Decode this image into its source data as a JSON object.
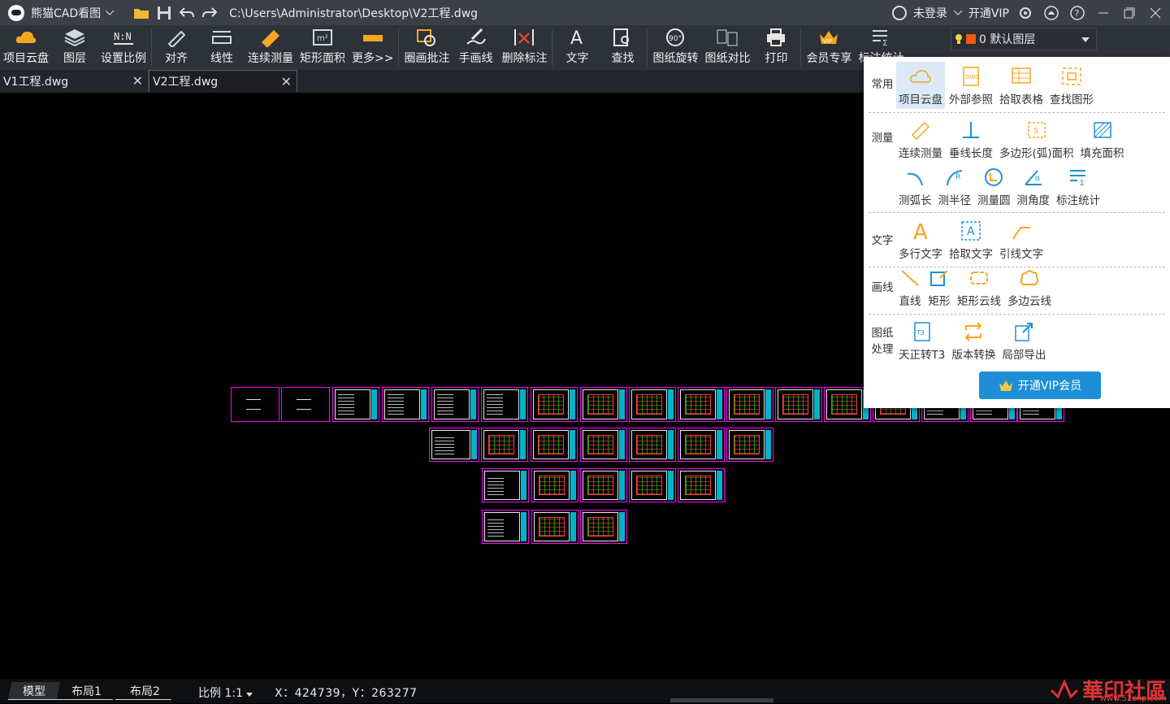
{
  "titlebar": {
    "app_name": "熊猫CAD看图",
    "file_path": "C:\\Users\\Administrator\\Desktop\\V2工程.dwg",
    "login": "未登录",
    "vip": "开通VIP"
  },
  "toolbar": {
    "items": [
      {
        "label": "项目云盘",
        "icon": "cloud-disk-icon"
      },
      {
        "label": "图层",
        "icon": "layers-icon"
      },
      {
        "label": "设置比例",
        "icon": "scale-ratio-icon"
      },
      {
        "label": "对齐",
        "icon": "align-icon"
      },
      {
        "label": "线性",
        "icon": "linear-measure-icon"
      },
      {
        "label": "连续测量",
        "icon": "continuous-measure-icon"
      },
      {
        "label": "矩形面积",
        "icon": "rect-area-icon"
      },
      {
        "label": "更多>>",
        "icon": "more-icon"
      },
      {
        "label": "圈画批注",
        "icon": "circle-annotate-icon"
      },
      {
        "label": "手画线",
        "icon": "freehand-icon"
      },
      {
        "label": "删除标注",
        "icon": "delete-annotation-icon"
      },
      {
        "label": "文字",
        "icon": "text-icon"
      },
      {
        "label": "查找",
        "icon": "find-icon"
      },
      {
        "label": "图纸旋转",
        "icon": "rotate-icon"
      },
      {
        "label": "图纸对比",
        "icon": "compare-icon"
      },
      {
        "label": "打印",
        "icon": "print-icon"
      },
      {
        "label": "会员专享",
        "icon": "vip-crown-icon"
      },
      {
        "label": "标注统计",
        "icon": "annotation-stats-icon"
      }
    ],
    "layer_select": "0 默认图层"
  },
  "tabs": [
    {
      "label": "V1工程.dwg"
    },
    {
      "label": "V2工程.dwg"
    }
  ],
  "dropdown": {
    "sections": [
      {
        "label": "常用",
        "items": [
          "项目云盘",
          "外部参照",
          "拾取表格",
          "查找图形"
        ]
      },
      {
        "label": "测量",
        "items": [
          "连续测量",
          "垂线长度",
          "多边形(弧)面积",
          "填充面积",
          "测弧长",
          "测半径",
          "测量圆",
          "测角度",
          "标注统计"
        ]
      },
      {
        "label": "文字",
        "items": [
          "多行文字",
          "拾取文字",
          "引线文字"
        ]
      },
      {
        "label": "画线",
        "items": [
          "直线",
          "矩形",
          "矩形云线",
          "多边云线"
        ]
      },
      {
        "label": "图纸处理",
        "items": [
          "天正转T3",
          "版本转换",
          "局部导出"
        ]
      }
    ],
    "vip_button": "开通VIP会员"
  },
  "status": {
    "layout_tabs": [
      "模型",
      "布局1",
      "布局2"
    ],
    "scale": "比例 1:1",
    "coords": "X：424739，Y：263277"
  },
  "watermark": {
    "text": "華印社區",
    "url": "www.52cnp.com"
  },
  "colors": {
    "accent": "#1e8fd6",
    "sheet_border": "#ff00ff",
    "highlight": "#dce9f7",
    "icon_orange": "#f5a623"
  }
}
